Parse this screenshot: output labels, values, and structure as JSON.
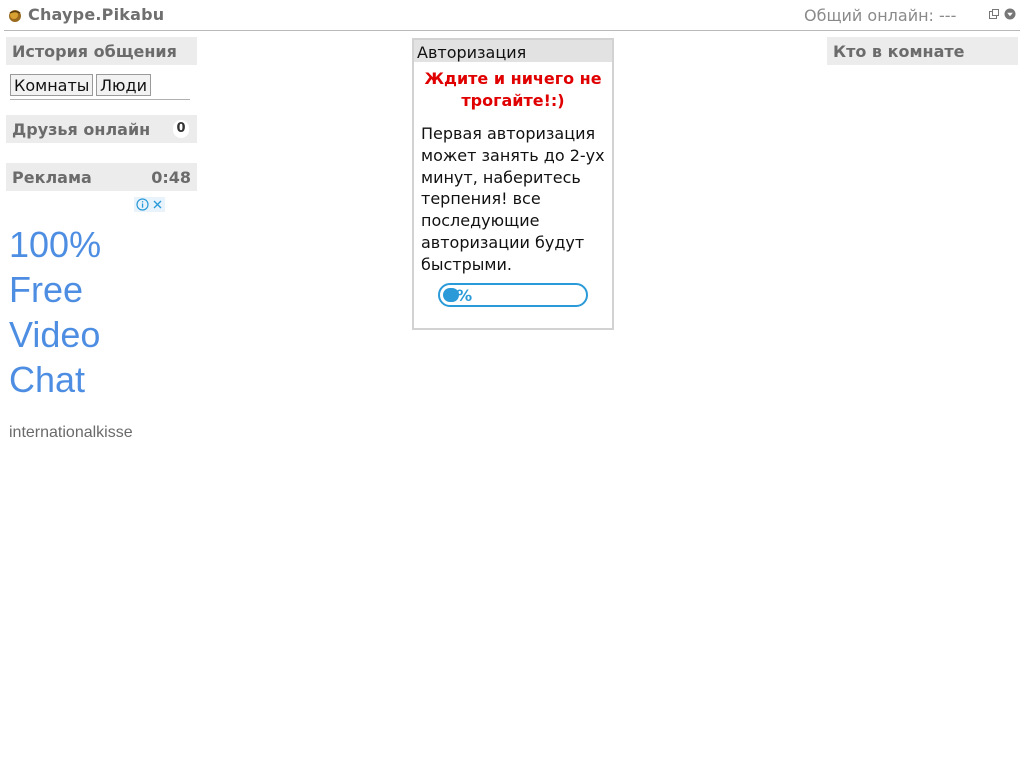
{
  "header": {
    "app_title": "Chaype.Pikabu",
    "online_total": "Общий онлайн: ---",
    "icons": [
      "coffee-logo-icon",
      "popout-icon",
      "dropdown-menu-icon"
    ]
  },
  "left": {
    "history": {
      "title": "История общения",
      "tabs": [
        "Комнаты",
        "Люди"
      ]
    },
    "friends": {
      "title": "Друзья онлайн",
      "count": "0"
    },
    "ads": {
      "title": "Реклама",
      "timer": "0:48",
      "headline": [
        "100%",
        "Free",
        "Video",
        "Chat"
      ],
      "domain": "internationalkisse",
      "icons": [
        "ad-info-icon",
        "ad-close-icon"
      ]
    }
  },
  "auth_dialog": {
    "title": "Авторизация",
    "warning": "Ждите и ничего не трогайте!:)",
    "message": "Первая авторизация может занять до 2-ух минут, наберитесь терпения! все последующие авторизации будут быстрыми.",
    "progress": {
      "percent": 2,
      "label": "2%"
    }
  },
  "right": {
    "room": {
      "title": "Кто в комнате"
    }
  },
  "colors": {
    "accent_blue": "#2a9ad8",
    "warning_red": "#e00000",
    "ad_link": "#4d8ee3",
    "panel_header": "#ececec"
  }
}
